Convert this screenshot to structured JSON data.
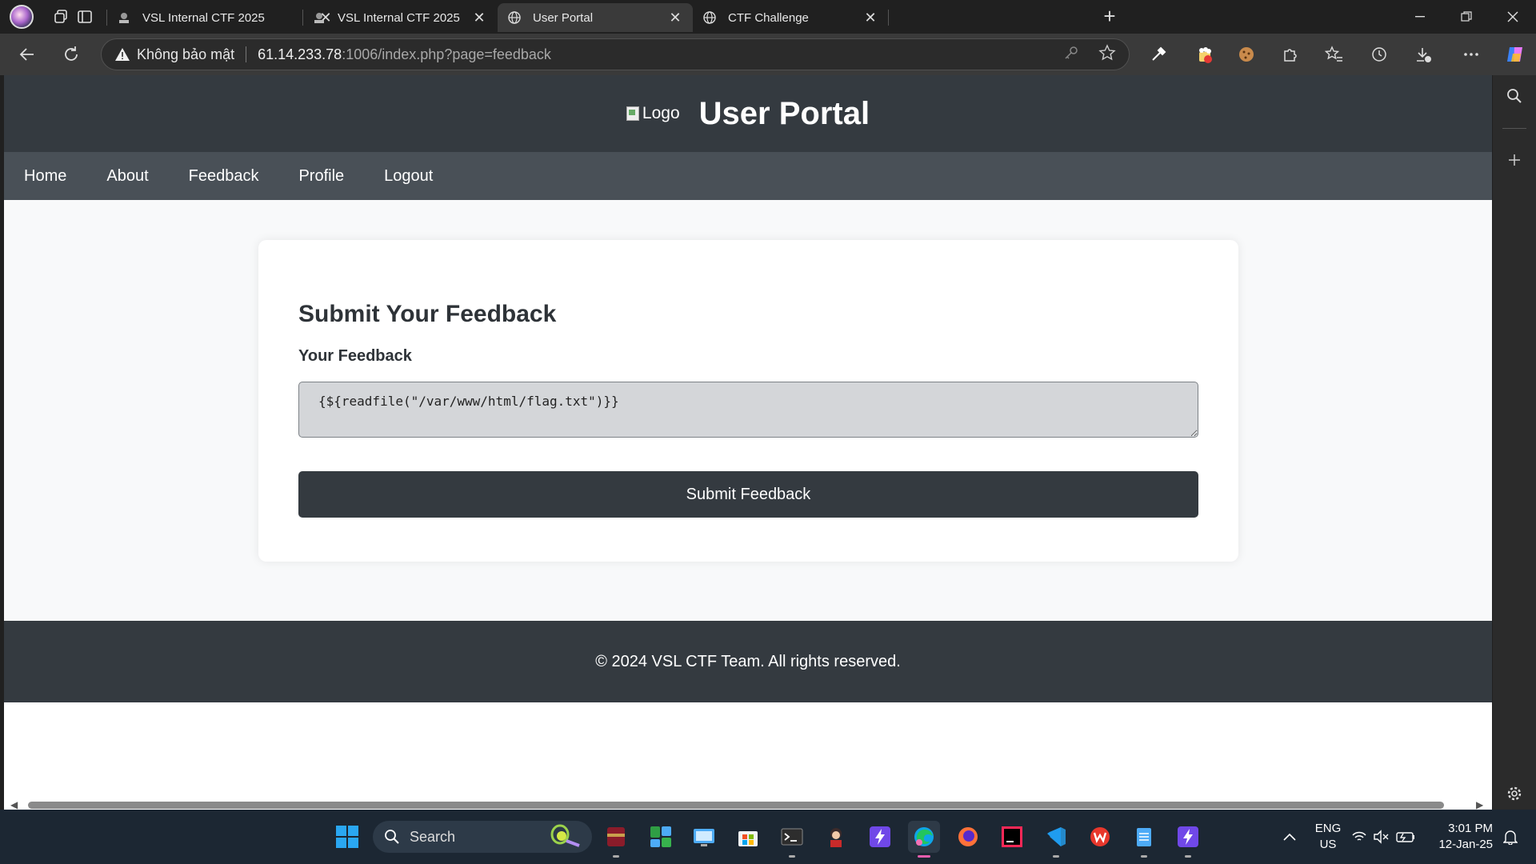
{
  "browser": {
    "tabs": [
      {
        "label": "VSL Internal CTF 2025",
        "active": false
      },
      {
        "label": "VSL Internal CTF 2025",
        "active": false
      },
      {
        "label": "User Portal",
        "active": true
      },
      {
        "label": "CTF Challenge",
        "active": false
      }
    ],
    "security_label": "Không bảo mật",
    "url_host": "61.14.233.78",
    "url_path": ":1006/index.php?page=feedback"
  },
  "page": {
    "logo_alt": "Logo",
    "site_title": "User Portal",
    "nav": [
      "Home",
      "About",
      "Feedback",
      "Profile",
      "Logout"
    ],
    "form": {
      "heading": "Submit Your Feedback",
      "label": "Your Feedback",
      "textarea_value": "{${readfile(\"/var/www/html/flag.txt\")}}",
      "submit_label": "Submit Feedback"
    },
    "footer": "© 2024 VSL CTF Team. All rights reserved."
  },
  "taskbar": {
    "search_label": "Search",
    "lang_line1": "ENG",
    "lang_line2": "US",
    "time": "3:01 PM",
    "date": "12-Jan-25"
  },
  "colors": {
    "header_bg": "#343a40",
    "nav_bg": "#495057",
    "page_bg": "#f8f9fa",
    "chrome_bg": "#202020"
  }
}
